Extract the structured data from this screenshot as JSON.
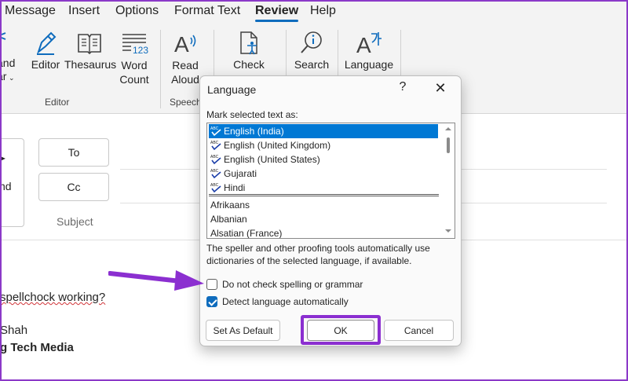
{
  "menu_tabs": [
    "Message",
    "Insert",
    "Options",
    "Format Text",
    "Review",
    "Help"
  ],
  "active_tab": "Review",
  "ribbon": {
    "partial_label_1": "and",
    "partial_label_2": "ar",
    "editor": "Editor",
    "thesaurus": "Thesaurus",
    "word_count_1": "Word",
    "word_count_2": "Count",
    "read_aloud_1": "Read",
    "read_aloud_2": "Aloud",
    "check": "Check",
    "search": "Search",
    "language": "Language",
    "group_editor": "Editor",
    "group_speech": "Speech"
  },
  "compose": {
    "send_label": "nd",
    "to_button": "To",
    "cc_button": "Cc",
    "subject_placeholder": "Subject",
    "body_line1": "spellchock working?",
    "body_line2": "Shah",
    "body_line3": "g Tech Media"
  },
  "dialog": {
    "title": "Language",
    "help": "?",
    "close": "✕",
    "mark_label": "Mark selected text as:",
    "proofing_languages": [
      "English (India)",
      "English (United Kingdom)",
      "English (United States)",
      "Gujarati",
      "Hindi"
    ],
    "selected_language": "English (India)",
    "other_languages": [
      "Afrikaans",
      "Albanian",
      "Alsatian (France)"
    ],
    "note": "The speller and other proofing tools automatically use dictionaries of the selected language, if available.",
    "do_not_check_label": "Do not check spelling or grammar",
    "do_not_check_checked": false,
    "detect_label": "Detect language automatically",
    "detect_checked": true,
    "set_default_button": "Set As Default",
    "ok_button": "OK",
    "cancel_button": "Cancel"
  },
  "colors": {
    "highlight": "#8b2fd0",
    "selection": "#0078d4",
    "accent": "#0f6cbd"
  }
}
